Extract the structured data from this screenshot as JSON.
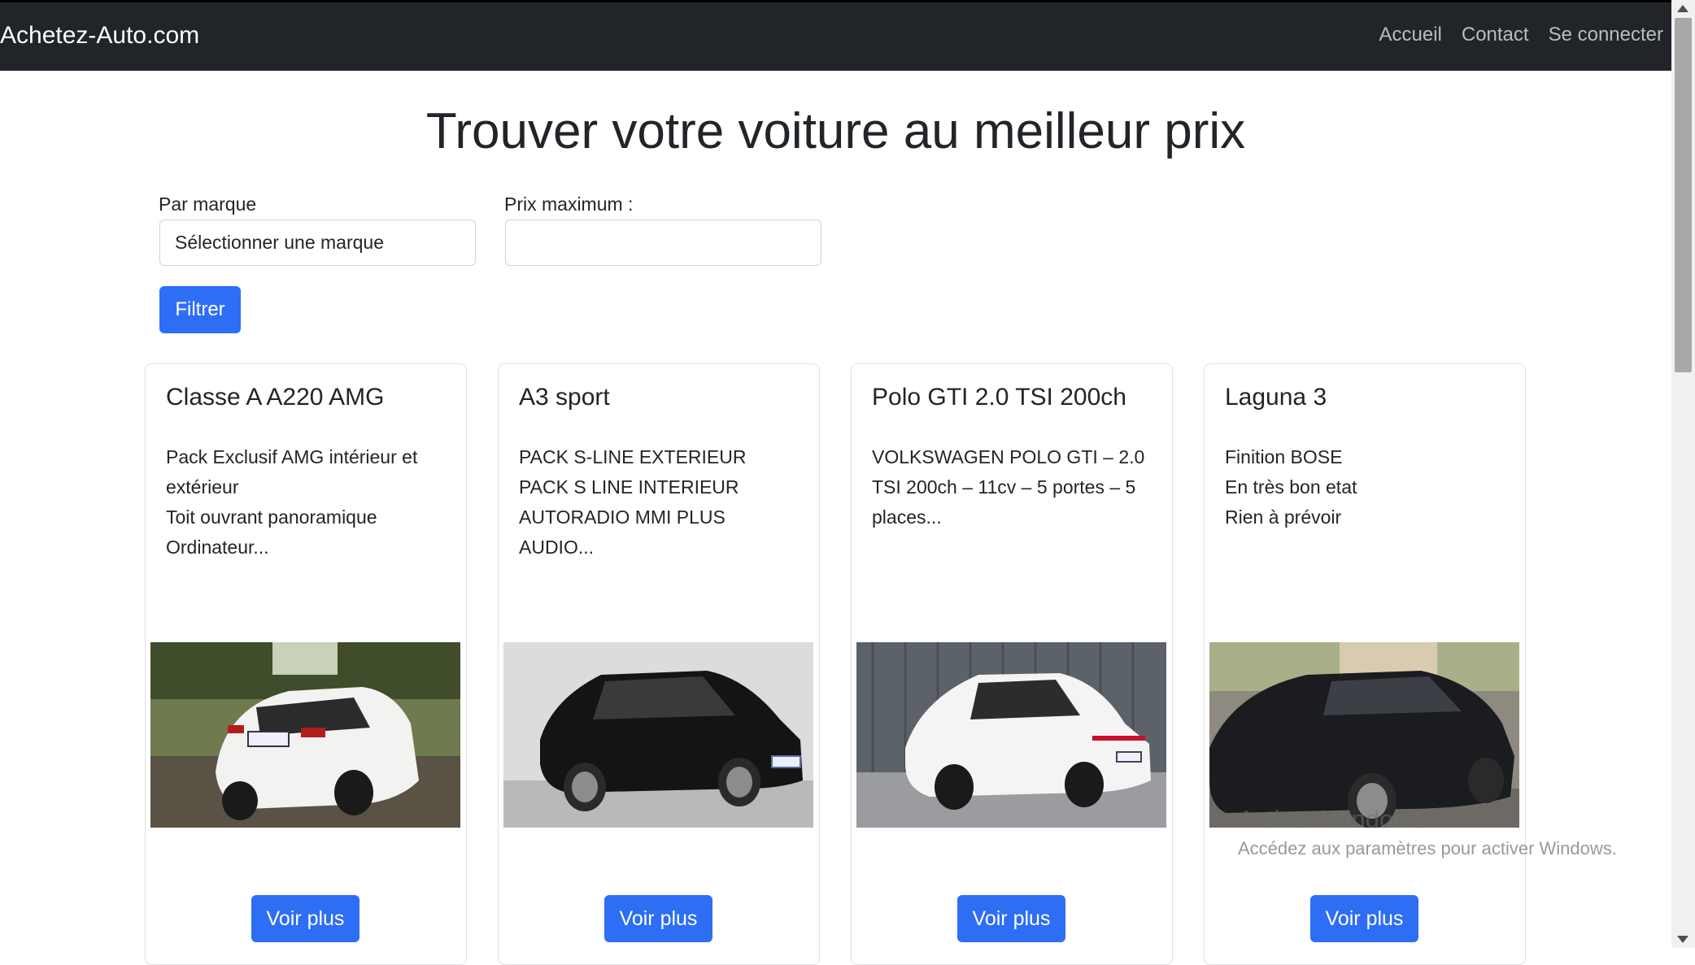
{
  "navbar": {
    "brand": "Achetez-Auto.com",
    "links": [
      "Accueil",
      "Contact",
      "Se connecter"
    ]
  },
  "title": "Trouver votre voiture au meilleur prix",
  "filters": {
    "brand_label": "Par marque",
    "brand_value": "Sélectionner une marque",
    "price_label": "Prix maximum :",
    "price_value": "",
    "submit_label": "Filtrer"
  },
  "cars": [
    {
      "title": "Classe A A220 AMG",
      "description": "Pack Exclusif AMG intérieur et extérieur\nToit ouvrant panoramique\nOrdinateur...",
      "image": "white-mercedes-rear-photo",
      "button": "Voir plus"
    },
    {
      "title": "A3 sport",
      "description": "PACK S-LINE EXTERIEUR\nPACK S LINE INTERIEUR\nAUTORADIO MMI PLUS\nAUDIO...",
      "image": "black-audi-a3-photo",
      "button": "Voir plus"
    },
    {
      "title": "Polo GTI 2.0 TSI 200ch",
      "description": "VOLKSWAGEN POLO GTI – 2.0 TSI 200ch – 11cv – 5 portes – 5 places...",
      "image": "white-vw-polo-gti-photo",
      "button": "Voir plus"
    },
    {
      "title": "Laguna 3",
      "description": "Finition BOSE\nEn très bon etat\nRien à prévoir",
      "image": "black-renault-laguna-coupe-photo",
      "button": "Voir plus"
    }
  ],
  "watermark": {
    "line1": "Activer Windows",
    "line2": "Accédez aux paramètres pour activer Windows."
  },
  "colors": {
    "navbar": "#212529",
    "primary": "#2d6ef5"
  }
}
